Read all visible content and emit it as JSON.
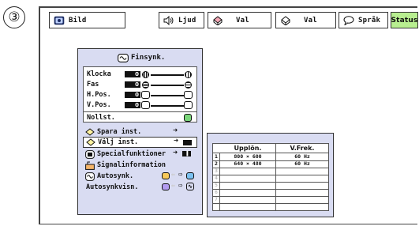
{
  "step_marker": "③",
  "top_menu": {
    "tabs": [
      {
        "label": "Bild",
        "icon": "picture-icon"
      },
      {
        "label": "Ljud",
        "icon": "speaker-icon"
      },
      {
        "label": "Val",
        "icon": "options-icon"
      },
      {
        "label": "Val",
        "icon": "options-icon"
      },
      {
        "label": "Språk",
        "icon": "speech-bubble-icon"
      },
      {
        "label": "Status",
        "icon": ""
      }
    ]
  },
  "finsynk_menu": {
    "title": "Finsynk.",
    "adjust_rows": [
      {
        "label": "Klocka",
        "value": "0"
      },
      {
        "label": "Fas",
        "value": "0"
      },
      {
        "label": "H.Pos.",
        "value": "0"
      },
      {
        "label": "V.Pos.",
        "value": "0"
      }
    ],
    "reset_label": "Nollst.",
    "items": [
      {
        "label": "Spara inst.",
        "icon": "save-diamond-icon"
      },
      {
        "label": "Välj inst.",
        "icon": "select-diamond-icon"
      },
      {
        "label": "Specialfunktioner",
        "icon": "special-functions-icon"
      },
      {
        "label": "Signalinformation",
        "icon": "signal-info-icon"
      },
      {
        "label": "Autosynk.",
        "icon": "autosync-icon"
      },
      {
        "label": "Autosynkvisn.",
        "icon": "autosync-display-icon"
      }
    ]
  },
  "resolution_table": {
    "headers": [
      "Upplön.",
      "V.Frek."
    ],
    "rows": [
      {
        "num": "1",
        "resolution": "800 × 600",
        "freq": "60 Hz"
      },
      {
        "num": "2",
        "resolution": "640 × 480",
        "freq": "60 Hz"
      },
      {
        "num": "3",
        "resolution": "",
        "freq": ""
      },
      {
        "num": "4",
        "resolution": "",
        "freq": ""
      },
      {
        "num": "5",
        "resolution": "",
        "freq": ""
      },
      {
        "num": "6",
        "resolution": "",
        "freq": ""
      },
      {
        "num": "7",
        "resolution": "",
        "freq": ""
      }
    ]
  },
  "colors": {
    "status_tab": "#b8ef90",
    "menu_bg": "#d9dcf2"
  }
}
